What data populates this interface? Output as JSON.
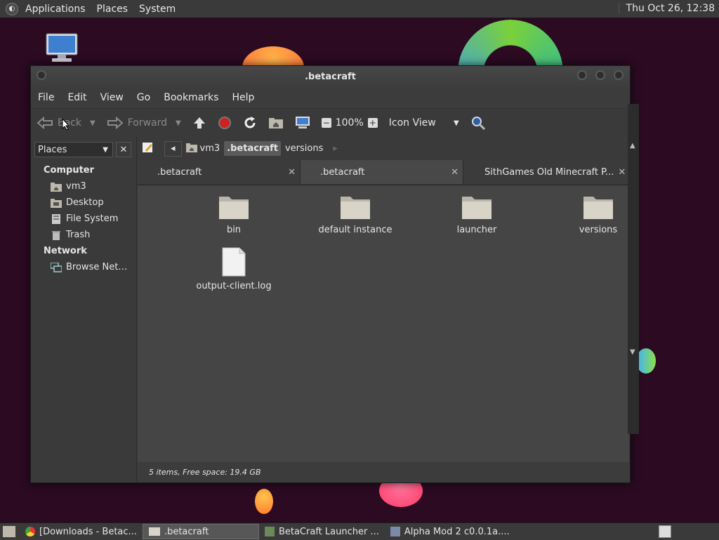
{
  "top_panel": {
    "menus": [
      "Applications",
      "Places",
      "System"
    ],
    "clock": "Thu Oct 26, 12:38"
  },
  "window": {
    "title": ".betacraft",
    "menubar": [
      "File",
      "Edit",
      "View",
      "Go",
      "Bookmarks",
      "Help"
    ],
    "toolbar": {
      "back": "Back",
      "forward": "Forward",
      "zoom": "100%",
      "view_mode": "Icon View"
    },
    "sidebar": {
      "combo": "Places",
      "sections": [
        {
          "title": "Computer",
          "items": [
            "vm3",
            "Desktop",
            "File System",
            "Trash"
          ]
        },
        {
          "title": "Network",
          "items": [
            "Browse Net…"
          ]
        }
      ]
    },
    "pathbar": {
      "crumbs": [
        "vm3",
        ".betacraft",
        "versions"
      ],
      "active_index": 1
    },
    "tabs": [
      {
        "label": ".betacraft",
        "active": false
      },
      {
        "label": ".betacraft",
        "active": true
      },
      {
        "label": "SithGames Old Minecraft P...",
        "active": false
      }
    ],
    "files": [
      {
        "name": "bin",
        "type": "folder"
      },
      {
        "name": "default instance",
        "type": "folder"
      },
      {
        "name": "launcher",
        "type": "folder"
      },
      {
        "name": "versions",
        "type": "folder"
      },
      {
        "name": "output-client.log",
        "type": "file"
      }
    ],
    "status": "5 items, Free space: 19.4 GB"
  },
  "taskbar": [
    {
      "label": "[Downloads - Betac...",
      "icon": "chrome-icon",
      "active": false
    },
    {
      "label": ".betacraft",
      "icon": "folder-icon",
      "active": true
    },
    {
      "label": "BetaCraft Launcher ...",
      "icon": "app-icon",
      "active": false
    },
    {
      "label": "Alpha Mod 2 c0.0.1a....",
      "icon": "java-icon",
      "active": false
    }
  ],
  "colors": {
    "desktop_bg": "#2b0a22",
    "panel_bg": "#3a3a3a",
    "window_bg": "#3c3c3c",
    "content_bg": "#454545",
    "folder": "#d8d4c8"
  }
}
